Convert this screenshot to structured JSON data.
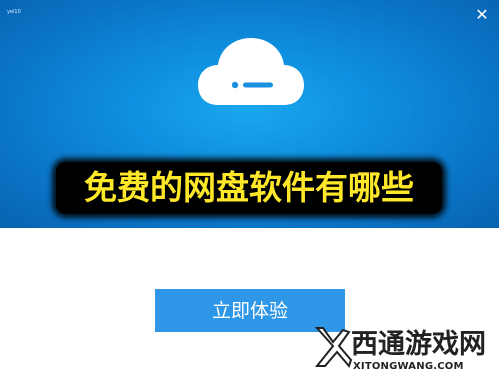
{
  "window": {
    "title": "yel10"
  },
  "controls": {
    "close_icon": "close-icon",
    "close_glyph": "✕"
  },
  "hero": {
    "cloud_icon": "cloud-icon",
    "headline": "免费的网盘软件有哪些"
  },
  "cta": {
    "label": "立即体验"
  },
  "watermark": {
    "name_cn": "西通游戏网",
    "name_en": "XITONGWANG.COM"
  },
  "colors": {
    "hero_blue": "#0f8fdf",
    "button_blue": "#2f97e8",
    "headline_yellow": "#ffe829"
  }
}
